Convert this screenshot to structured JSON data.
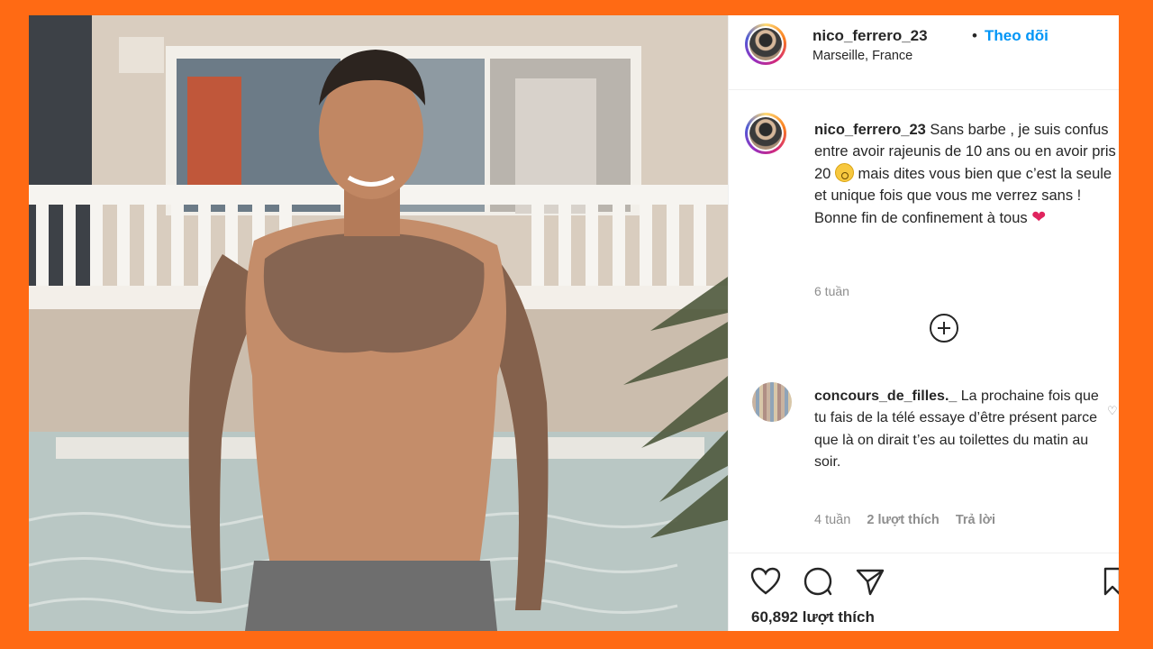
{
  "post": {
    "username": "nico_ferrero_23",
    "dot": "•",
    "follow_label": "Theo dõi",
    "location": "Marseille, France"
  },
  "caption": {
    "username": "nico_ferrero_23",
    "line1": " Sans barbe , je suis confus entre avoir rajeunis de 10 ans ou en avoir pris 20 ",
    "emoji1": "flushed-face-emoji",
    "line2": " mais dites vous bien que c’est la seule et unique fois que vous me verrez sans !",
    "line3": "Bonne fin de confinement à tous ",
    "emoji2": "❤",
    "time": "6 tuần"
  },
  "comment": {
    "username": "concours_de_filles._",
    "text": " La prochaine fois que tu fais de la télé essaye d’être présent parce que là on dirait t’es au toilettes du matin au soir.",
    "time": "4 tuần",
    "likes": "2 lượt thích",
    "reply": "Trả lời"
  },
  "actions": {
    "icons": [
      "heart-icon",
      "comment-icon",
      "share-icon",
      "bookmark-icon"
    ],
    "likes": "60,892 lượt thích"
  },
  "colors": {
    "border": "#ff6a14",
    "link_blue": "#0095f6",
    "text": "#262626",
    "muted": "#8e8e8e"
  }
}
